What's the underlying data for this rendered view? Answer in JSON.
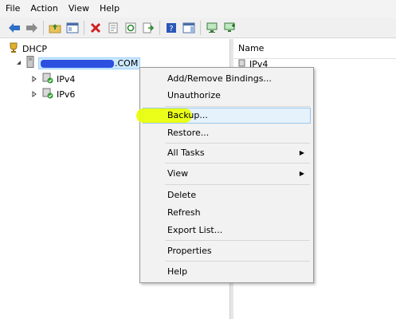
{
  "menubar": {
    "items": [
      "File",
      "Action",
      "View",
      "Help"
    ]
  },
  "toolbar": {
    "icons": [
      "back-icon",
      "forward-icon",
      "up-folder-icon",
      "show-hide-tree-icon",
      "delete-icon",
      "properties-icon",
      "refresh-icon",
      "export-list-icon",
      "help-icon",
      "action-pane-icon",
      "server-icon",
      "add-server-icon"
    ]
  },
  "tree": {
    "root_label": "DHCP",
    "server_label_visible": ".COM",
    "children": [
      {
        "label": "IPv4"
      },
      {
        "label": "IPv6"
      }
    ]
  },
  "right_pane": {
    "column_header": "Name",
    "rows": [
      "IPv4"
    ]
  },
  "context_menu": {
    "items": [
      {
        "label": "Add/Remove Bindings..."
      },
      {
        "label": "Unauthorize"
      },
      {
        "label": "Backup..."
      },
      {
        "label": "Restore..."
      },
      {
        "label": "All Tasks"
      },
      {
        "label": "View"
      },
      {
        "label": "Delete"
      },
      {
        "label": "Refresh"
      },
      {
        "label": "Export List..."
      },
      {
        "label": "Properties"
      },
      {
        "label": "Help"
      }
    ],
    "highlighted": "Backup..."
  },
  "colors": {
    "highlight_marker": "#eaff00",
    "redaction": "#2d4fe0",
    "selection": "#cde8ff"
  }
}
